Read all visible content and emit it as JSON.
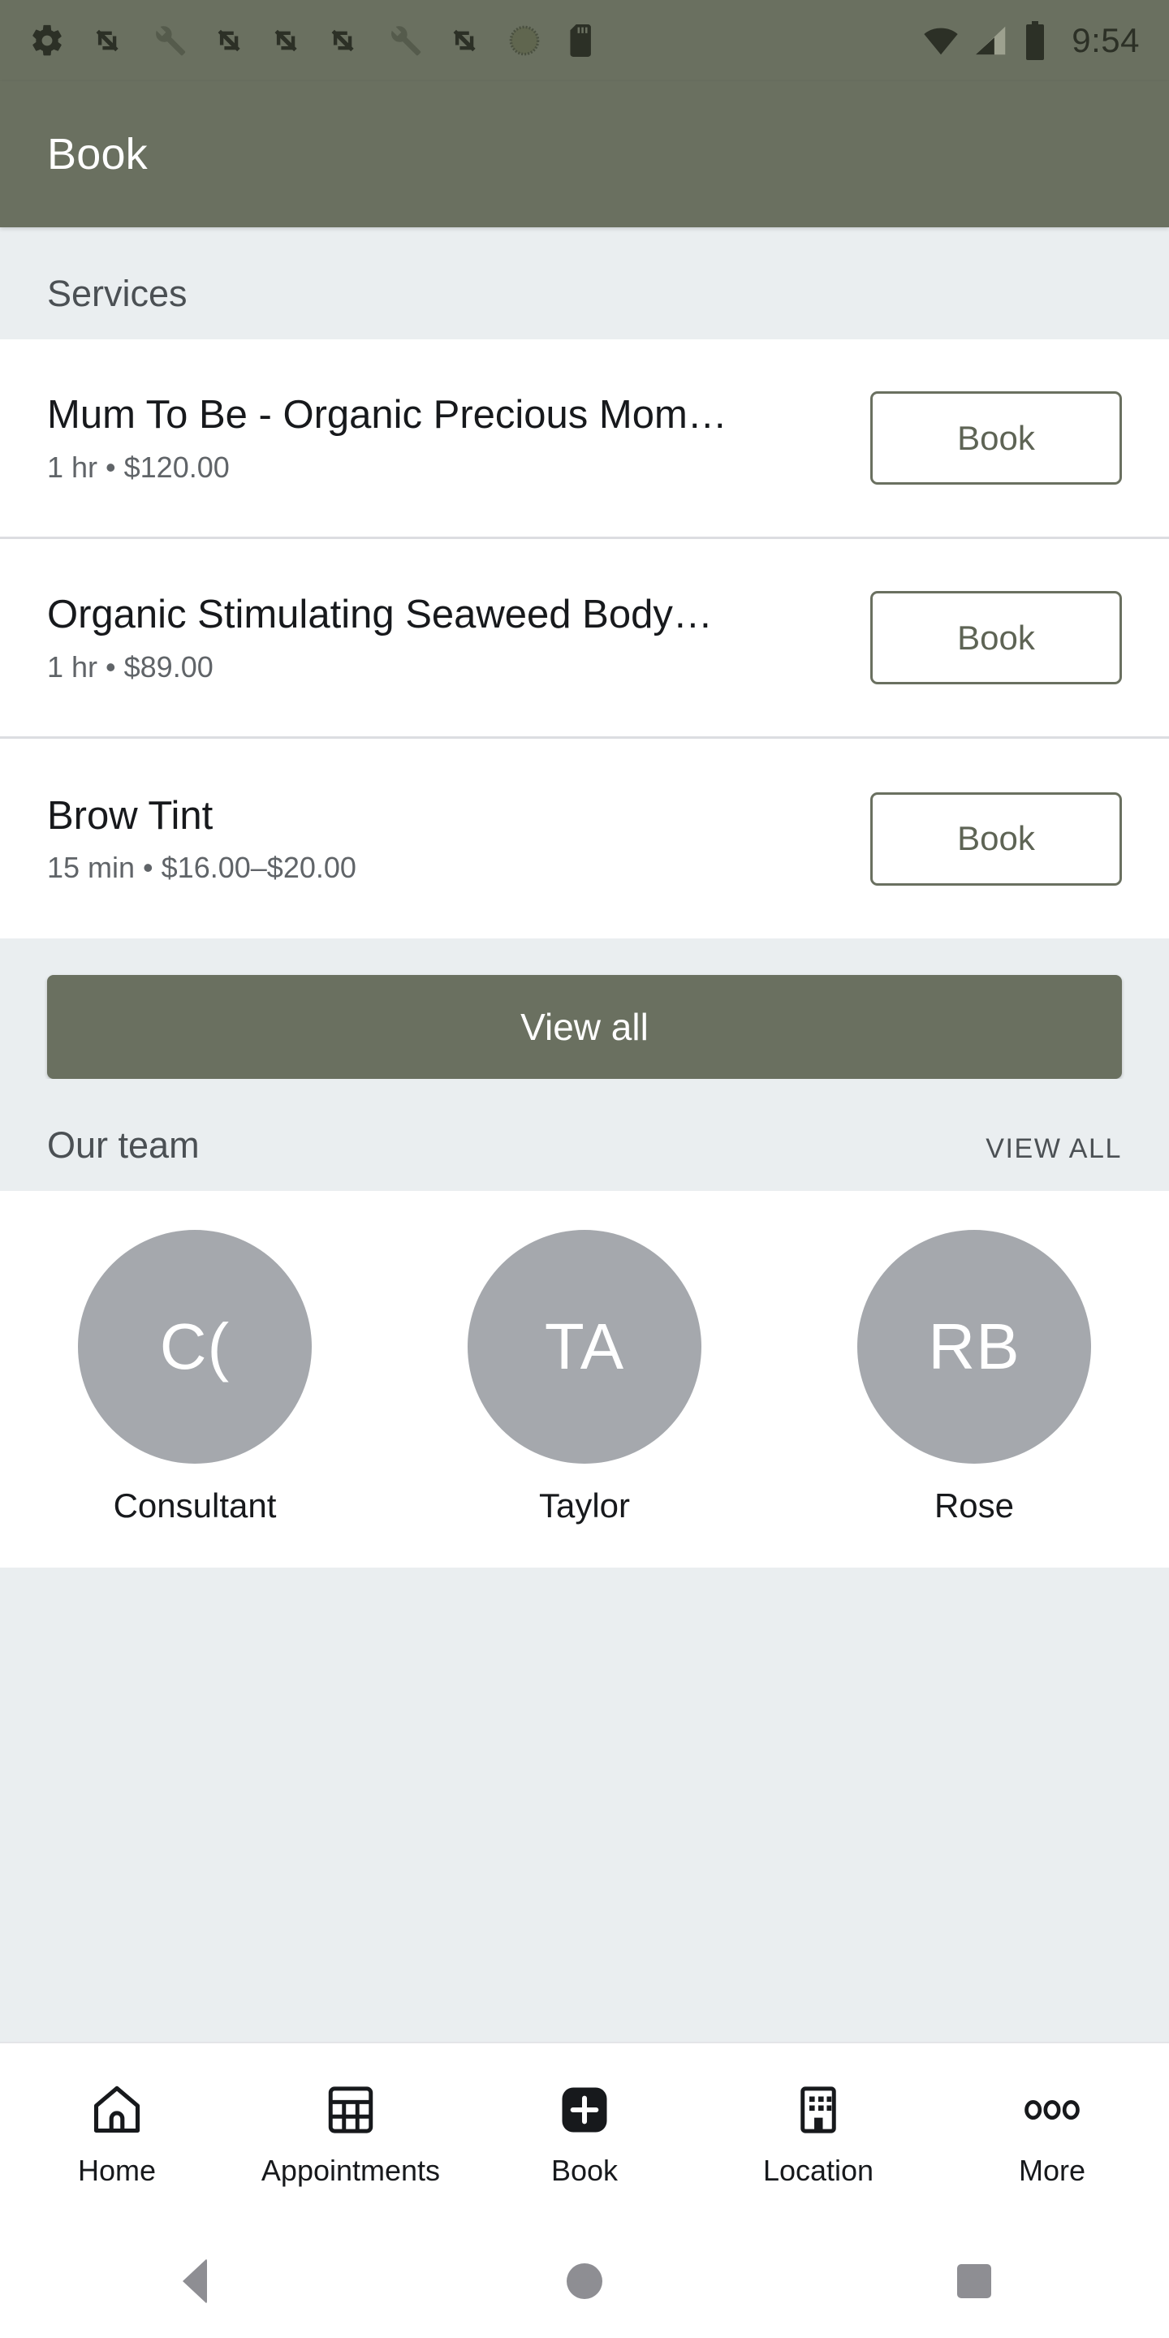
{
  "statusbar": {
    "time": "9:54",
    "left_icons": [
      "gear-icon",
      "sync-arrows-icon",
      "wrench-icon",
      "sync-arrows-icon",
      "sync-arrows-icon",
      "sync-arrows-icon",
      "wrench-icon",
      "sync-arrows-icon",
      "circle-dotted-icon",
      "sd-card-icon"
    ],
    "right_icons": [
      "wifi-icon",
      "cellular-signal-icon",
      "battery-icon"
    ]
  },
  "appbar": {
    "title": "Book",
    "background": "#6a7060"
  },
  "services_section": {
    "title": "Services",
    "items": [
      {
        "name": "Mum To Be - Organic Precious Mom…",
        "meta": "1 hr • $120.00",
        "button_label": "Book"
      },
      {
        "name": "Organic Stimulating Seaweed Body…",
        "meta": "1 hr • $89.00",
        "button_label": "Book"
      },
      {
        "name": "Brow Tint",
        "meta": "15 min • $16.00–$20.00",
        "button_label": "Book"
      }
    ],
    "view_all_label": "View all"
  },
  "team_section": {
    "title": "Our team",
    "view_all_label": "VIEW ALL",
    "members": [
      {
        "initials": "C(",
        "name": "Consultant"
      },
      {
        "initials": "TA",
        "name": "Taylor"
      },
      {
        "initials": "RB",
        "name": "Rose"
      }
    ]
  },
  "bottom_nav": {
    "items": [
      {
        "label": "Home",
        "icon": "home-icon"
      },
      {
        "label": "Appointments",
        "icon": "calendar-grid-icon"
      },
      {
        "label": "Book",
        "icon": "plus-square-icon"
      },
      {
        "label": "Location",
        "icon": "building-icon"
      },
      {
        "label": "More",
        "icon": "three-dots-icon"
      }
    ]
  },
  "android_nav": {
    "back": "back-triangle-icon",
    "home": "home-circle-icon",
    "recents": "recents-square-icon"
  },
  "colors": {
    "brand": "#6a7060",
    "page_background": "#eaeef0",
    "card_background": "#ffffff",
    "avatar": "#a5a8ad"
  }
}
